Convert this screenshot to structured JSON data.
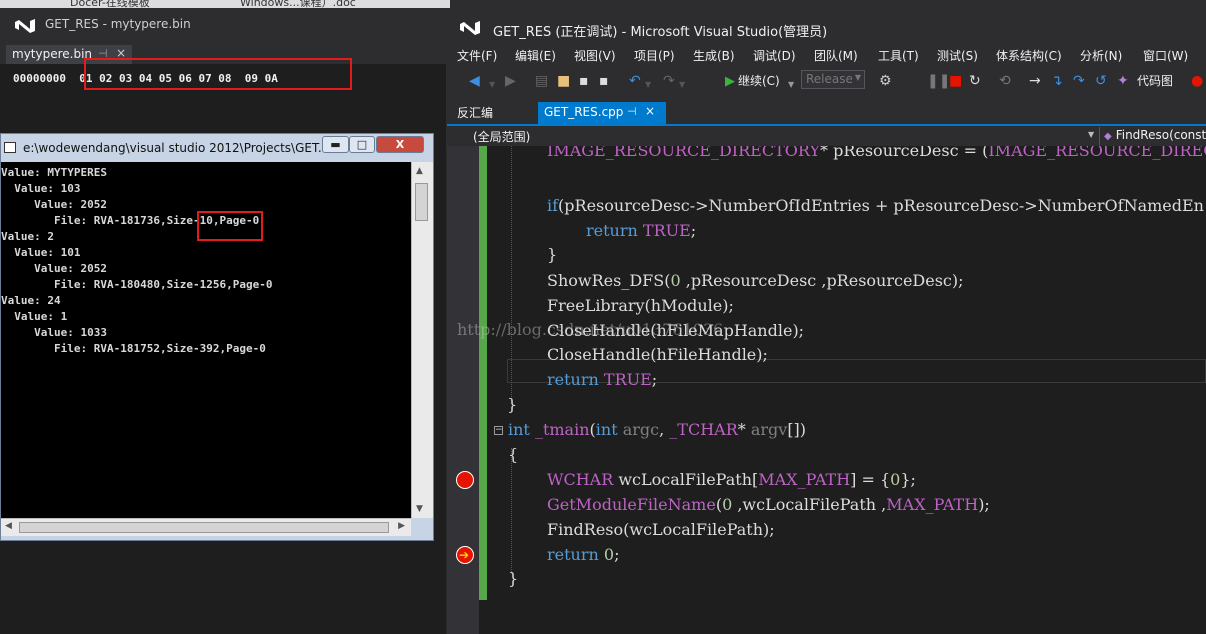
{
  "taskbar": {
    "tab1": "Docer-在线模板",
    "tab2": "Windows...课程）.doc"
  },
  "left_window": {
    "title": "GET_RES - mytypere.bin",
    "tab": {
      "label": "mytypere.bin",
      "pin": "⊣",
      "close": "×"
    },
    "hex": {
      "offset": "00000000",
      "bytes": "01 02 03 04 05 06 07 08  09 0A"
    }
  },
  "console": {
    "title": "e:\\wodewendang\\visual studio 2012\\Projects\\GET...",
    "buttons": {
      "min": "▬",
      "max": "□",
      "close": "X"
    },
    "lines": [
      "Value: MYTYPERES",
      "  Value: 103",
      "     Value: 2052",
      "        File: RVA-181736,Size-10,Page-0",
      "Value: 2",
      "  Value: 101",
      "     Value: 2052",
      "        File: RVA-180480,Size-1256,Page-0",
      "Value: 24",
      "  Value: 1",
      "     Value: 1033",
      "        File: RVA-181752,Size-392,Page-0"
    ]
  },
  "main_window": {
    "title": "GET_RES (正在调试) - Microsoft Visual Studio(管理员)",
    "menu": [
      "文件(F)",
      "编辑(E)",
      "视图(V)",
      "项目(P)",
      "生成(B)",
      "调试(D)",
      "团队(M)",
      "工具(T)",
      "测试(S)",
      "体系结构(C)",
      "分析(N)",
      "窗口(W)"
    ],
    "toolbar": {
      "continue": "继续(C)",
      "config": "Release",
      "code_map": "代码图"
    },
    "tabs": {
      "disassembly": "反汇编",
      "file": "GET_RES.cpp",
      "pin": "⊣",
      "close": "×"
    },
    "navbar": {
      "scope": "(全局范围)",
      "function": "FindReso(const"
    },
    "watermark": "http://blog.csdn.net/u013761036"
  },
  "colors": {
    "accent": "#007acc",
    "highlight_box": "#e21b1b",
    "breakpoint": "#e51400"
  }
}
